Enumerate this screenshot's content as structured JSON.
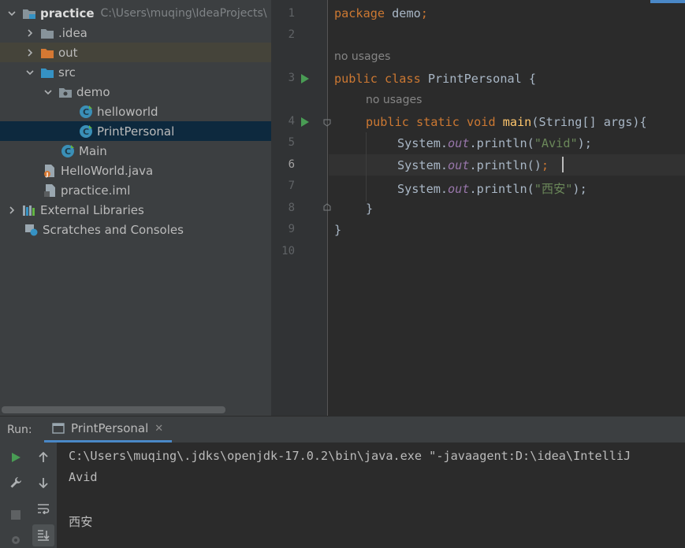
{
  "project_tree": {
    "root": {
      "name": "practice",
      "path": "C:\\Users\\muqing\\IdeaProjects\\"
    },
    "items": [
      {
        "label": ".idea"
      },
      {
        "label": "out"
      },
      {
        "label": "src"
      },
      {
        "label": "demo"
      },
      {
        "label": "helloworld"
      },
      {
        "label": "PrintPersonal"
      },
      {
        "label": "Main"
      },
      {
        "label": "HelloWorld.java"
      },
      {
        "label": "practice.iml"
      },
      {
        "label": "External Libraries"
      },
      {
        "label": "Scratches and Consoles"
      }
    ]
  },
  "editor": {
    "line_numbers": [
      "1",
      "2",
      "3",
      "4",
      "5",
      "6",
      "7",
      "8",
      "9",
      "10"
    ],
    "hints": {
      "usages_1": "no usages",
      "usages_2": "no usages"
    },
    "code": {
      "l1": {
        "kw": "package",
        "rest": " demo",
        "semi": ";"
      },
      "l3": {
        "kw": "public class",
        "rest": " PrintPersonal {"
      },
      "l4": {
        "kw": "public static void",
        "fn": "main",
        "rest": "(String[] args){"
      },
      "l5": {
        "pre": "System.",
        "field": "out",
        "mid": ".println(",
        "str": "\"Avid\"",
        "post": ");"
      },
      "l6": {
        "pre": "System.",
        "field": "out",
        "mid": ".println()",
        "semi": ";"
      },
      "l7": {
        "pre": "System.",
        "field": "out",
        "mid": ".println(",
        "str": "\"西安\"",
        "post": ");"
      },
      "l8": {
        "text": "}"
      },
      "l9": {
        "text": "}"
      }
    }
  },
  "run_panel": {
    "label": "Run:",
    "tab": "PrintPersonal",
    "output": [
      "C:\\Users\\muqing\\.jdks\\openjdk-17.0.2\\bin\\java.exe \"-javaagent:D:\\idea\\IntelliJ",
      "Avid",
      "",
      "西安"
    ]
  },
  "colors": {
    "accent": "#4a88c7",
    "keyword": "#cc7832",
    "string": "#6a8759",
    "function": "#ffc66d",
    "field": "#9876aa",
    "run_green": "#499c54"
  }
}
